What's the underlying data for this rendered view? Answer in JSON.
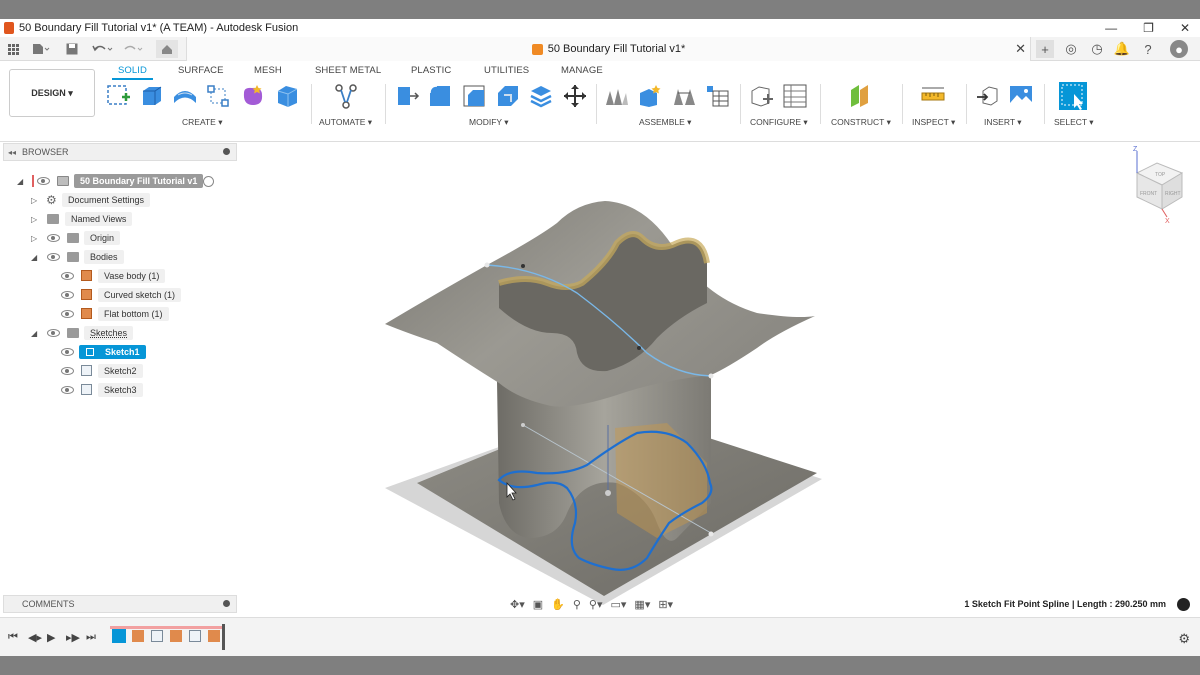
{
  "window": {
    "title": "50 Boundary Fill Tutorial v1* (A TEAM) - Autodesk Fusion",
    "minimize": "—",
    "maximize": "❐",
    "close": "✕"
  },
  "doc_tab": {
    "title": "50 Boundary Fill Tutorial v1*",
    "close": "✕"
  },
  "toolbar": {
    "workspace_button": "DESIGN ▾",
    "tabs": [
      "SOLID",
      "SURFACE",
      "MESH",
      "SHEET METAL",
      "PLASTIC",
      "UTILITIES",
      "MANAGE"
    ],
    "active_tab": "SOLID",
    "groups": {
      "create": "CREATE ▾",
      "automate": "AUTOMATE ▾",
      "modify": "MODIFY ▾",
      "assemble": "ASSEMBLE ▾",
      "configure": "CONFIGURE ▾",
      "construct": "CONSTRUCT ▾",
      "inspect": "INSPECT ▾",
      "insert": "INSERT ▾",
      "select": "SELECT ▾"
    }
  },
  "browser": {
    "header": "BROWSER",
    "root": "50 Boundary Fill Tutorial v1",
    "items": {
      "document_settings": "Document Settings",
      "named_views": "Named Views",
      "origin": "Origin",
      "bodies": "Bodies",
      "vase_body": "Vase body (1)",
      "curved_sketch": "Curved sketch (1)",
      "flat_bottom": "Flat bottom (1)",
      "sketches": "Sketches",
      "sketch1": "Sketch1",
      "sketch2": "Sketch2",
      "sketch3": "Sketch3"
    }
  },
  "comments": {
    "header": "COMMENTS"
  },
  "viewcube": {
    "top": "TOP",
    "front": "FRONT",
    "right": "RIGHT",
    "axis_z": "Z",
    "axis_x": "X"
  },
  "status": {
    "text": "1 Sketch Fit Point Spline | Length : 290.250 mm"
  },
  "icons": {
    "grid_menu": "grid-icon",
    "file": "file-icon",
    "save": "save-icon",
    "undo": "undo-icon",
    "redo": "redo-icon",
    "home": "home-icon"
  },
  "colors": {
    "accent": "#0696d7",
    "sketch_curve": "#1e6fd0",
    "body": "#8c8a84"
  }
}
